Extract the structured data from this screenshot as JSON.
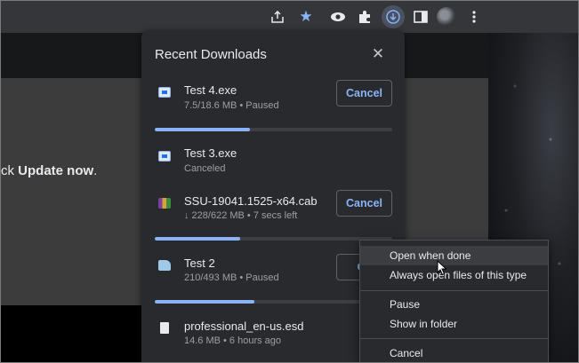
{
  "toolbar": {
    "icons": [
      "share-icon",
      "star-icon",
      "eye-icon",
      "puzzle-icon",
      "download-icon",
      "side-panel-icon",
      "avatar",
      "menu-icon"
    ],
    "accent": "#8ab4f8"
  },
  "page": {
    "text_prefix": "ck ",
    "text_bold": "Update now",
    "text_suffix": "."
  },
  "downloads": {
    "title": "Recent Downloads",
    "close_icon": "close-icon",
    "items": [
      {
        "name": "Test 4.exe",
        "status": "7.5/18.6 MB • Paused",
        "action": "Cancel",
        "progress": 0.4
      },
      {
        "name": "Test 3.exe",
        "status": "Canceled"
      },
      {
        "name": "SSU-19041.1525-x64.cab",
        "status": "↓ 228/622 MB • 7 secs left",
        "action": "Cancel",
        "progress": 0.36
      },
      {
        "name": "Test 2",
        "status": "210/493 MB • Paused",
        "action": "Ca",
        "progress": 0.42
      },
      {
        "name": "professional_en-us.esd",
        "status": "14.6 MB • 6 hours ago"
      }
    ]
  },
  "context_menu": {
    "items": [
      "Open when done",
      "Always open files of this type",
      "Pause",
      "Show in folder",
      "Cancel"
    ],
    "hovered": "Open when done"
  }
}
